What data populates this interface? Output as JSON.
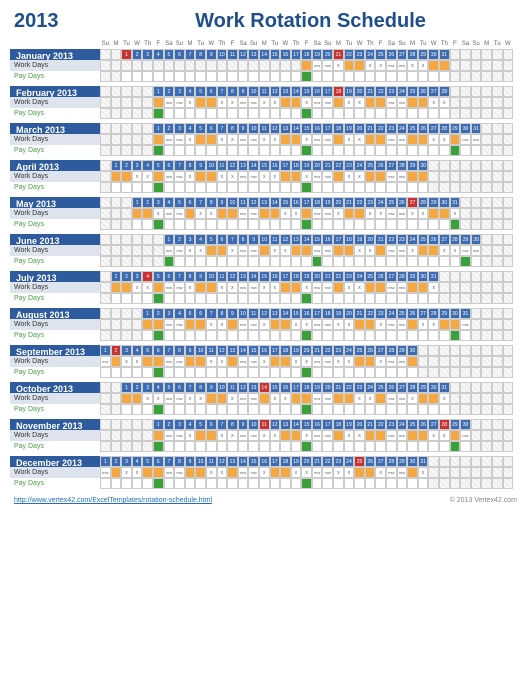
{
  "year": "2013",
  "title": "Work Rotation Schedule",
  "dow": [
    "Su",
    "M",
    "Tu",
    "W",
    "Th",
    "F",
    "Sa",
    "Su",
    "M",
    "Tu",
    "W",
    "Th",
    "F",
    "Sa",
    "Su",
    "M",
    "Tu",
    "W",
    "Th",
    "F",
    "Sa",
    "Su",
    "M",
    "Tu",
    "W",
    "Th",
    "F",
    "Sa",
    "Su",
    "M",
    "Tu",
    "W",
    "Th",
    "F",
    "Sa",
    "Su",
    "M",
    "Tu",
    "W"
  ],
  "row_labels": {
    "work": "Work Days",
    "pay": "Pay Days"
  },
  "months": [
    {
      "name": "January 2013",
      "offset": 2,
      "days": 31,
      "special": {
        "1": "red",
        "21": "red"
      },
      "work_start": 18,
      "pay_start": 18
    },
    {
      "name": "February 2013",
      "offset": 5,
      "days": 28,
      "special": {
        "18": "red"
      },
      "work_start": 1,
      "pay_start": 1
    },
    {
      "name": "March 2013",
      "offset": 5,
      "days": 31,
      "special": {},
      "work_start": 1,
      "pay_start": 1
    },
    {
      "name": "April 2013",
      "offset": 1,
      "days": 30,
      "special": {},
      "work_start": 1,
      "pay_start": 5
    },
    {
      "name": "May 2013",
      "offset": 3,
      "days": 31,
      "special": {
        "27": "red"
      },
      "work_start": 1,
      "pay_start": 3
    },
    {
      "name": "June 2013",
      "offset": 6,
      "days": 30,
      "special": {},
      "work_start": 1,
      "pay_start": 1
    },
    {
      "name": "July 2013",
      "offset": 1,
      "days": 31,
      "special": {
        "4": "red"
      },
      "work_start": 1,
      "pay_start": 5
    },
    {
      "name": "August 2013",
      "offset": 4,
      "days": 31,
      "special": {},
      "work_start": 1,
      "pay_start": 2
    },
    {
      "name": "September 2013",
      "offset": 0,
      "days": 30,
      "special": {
        "2": "red"
      },
      "work_start": 1,
      "pay_start": 6
    },
    {
      "name": "October 2013",
      "offset": 2,
      "days": 31,
      "special": {
        "14": "red"
      },
      "work_start": 1,
      "pay_start": 4
    },
    {
      "name": "November 2013",
      "offset": 5,
      "days": 30,
      "special": {
        "11": "red",
        "28": "red"
      },
      "work_start": 1,
      "pay_start": 1
    },
    {
      "name": "December 2013",
      "offset": 0,
      "days": 31,
      "special": {
        "25": "red"
      },
      "work_start": 1,
      "pay_start": 6
    }
  ],
  "footer": {
    "link_text": "http://www.vertex42.com/ExcelTemplates/rotation-schedule.html",
    "copy": "© 2013 Vertex42.com"
  },
  "total_cols": 39
}
